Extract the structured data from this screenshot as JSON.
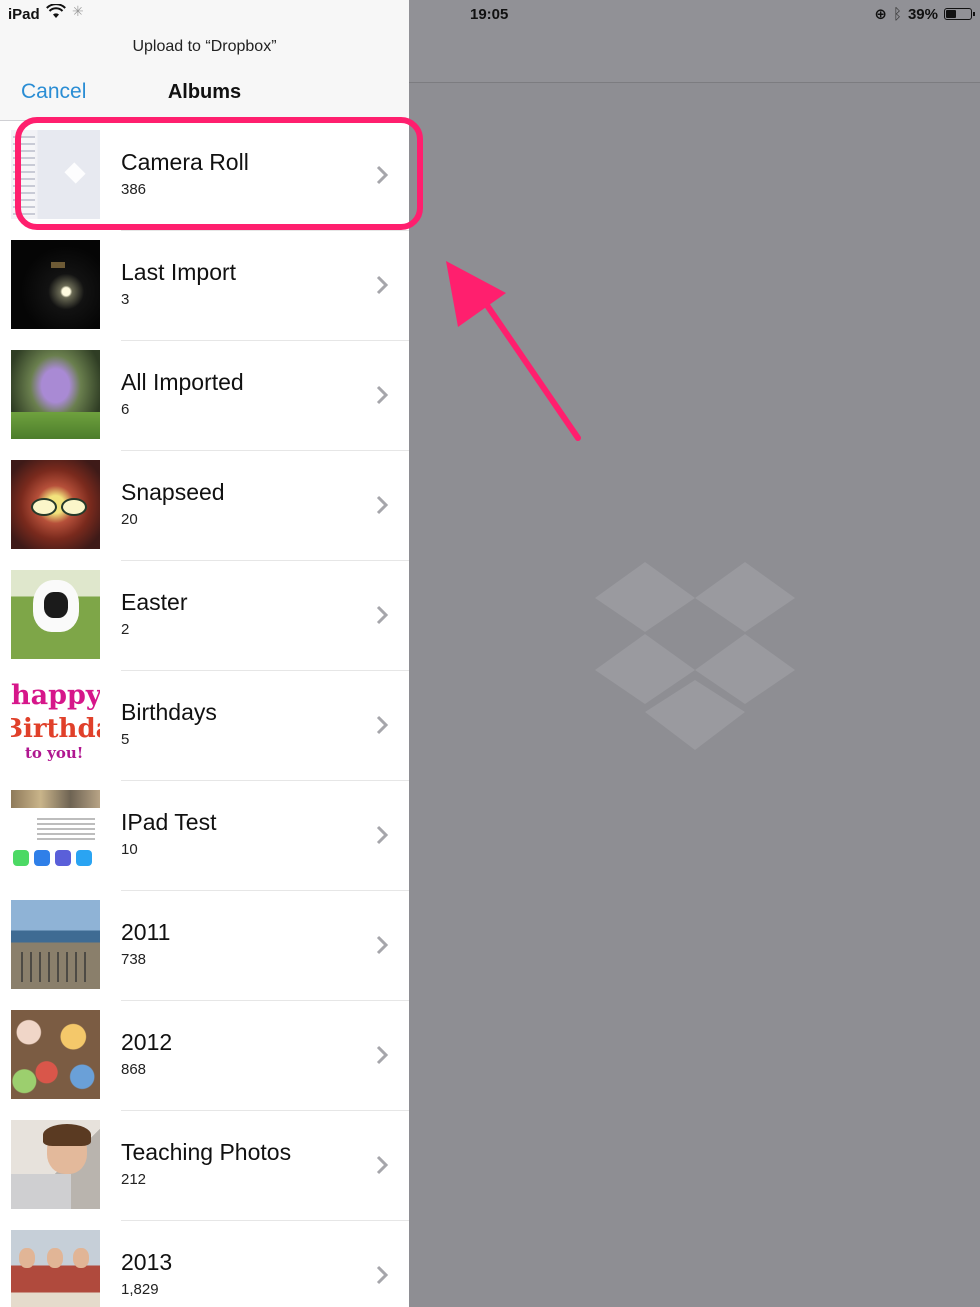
{
  "status_bar": {
    "carrier": "iPad",
    "time": "19:05",
    "battery": "39%",
    "battery_level": 0.39
  },
  "popover": {
    "prompt": "Upload to “Dropbox”",
    "cancel_label": "Cancel",
    "title": "Albums"
  },
  "albums": [
    {
      "name": "Camera Roll",
      "count": "386",
      "thumb_icon": "dropbox-screenshot-thumbnail"
    },
    {
      "name": "Last Import",
      "count": "3",
      "thumb_icon": "night-photo-thumbnail"
    },
    {
      "name": "All Imported",
      "count": "6",
      "thumb_icon": "flowers-photo-thumbnail"
    },
    {
      "name": "Snapseed",
      "count": "20",
      "thumb_icon": "portrait-photo-thumbnail"
    },
    {
      "name": "Easter",
      "count": "2",
      "thumb_icon": "lamb-photo-thumbnail"
    },
    {
      "name": "Birthdays",
      "count": "5",
      "thumb_icon": "birthday-card-thumbnail"
    },
    {
      "name": "IPad Test",
      "count": "10",
      "thumb_icon": "screenshot-thumbnail"
    },
    {
      "name": "2011",
      "count": "738",
      "thumb_icon": "bikes-photo-thumbnail"
    },
    {
      "name": "2012",
      "count": "868",
      "thumb_icon": "candy-photo-thumbnail"
    },
    {
      "name": "Teaching Photos",
      "count": "212",
      "thumb_icon": "child-photo-thumbnail"
    },
    {
      "name": "2013",
      "count": "1,829",
      "thumb_icon": "group-photo-thumbnail"
    }
  ],
  "birthday_card": {
    "line1": "happy",
    "line2": "Birthday",
    "line3": "to you!"
  },
  "colors": {
    "accent": "#2a8dd4",
    "annotation": "#ff1f6e",
    "background": "#8e8e93"
  }
}
